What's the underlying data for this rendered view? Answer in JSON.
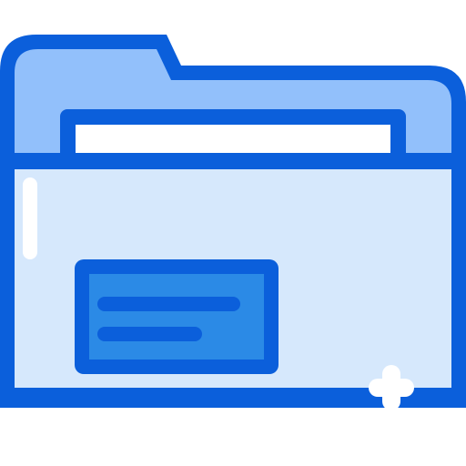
{
  "icon": {
    "name": "folder-icon",
    "colors": {
      "outline": "#0b5fdb",
      "tab_fill": "#92c0fb",
      "body_fill": "#d6e8fc",
      "document_fill": "#ffffff",
      "label_fill": "#2b8ae6",
      "highlight": "#ffffff"
    },
    "decorations": [
      "sparkle-icon",
      "shine-highlight"
    ]
  }
}
